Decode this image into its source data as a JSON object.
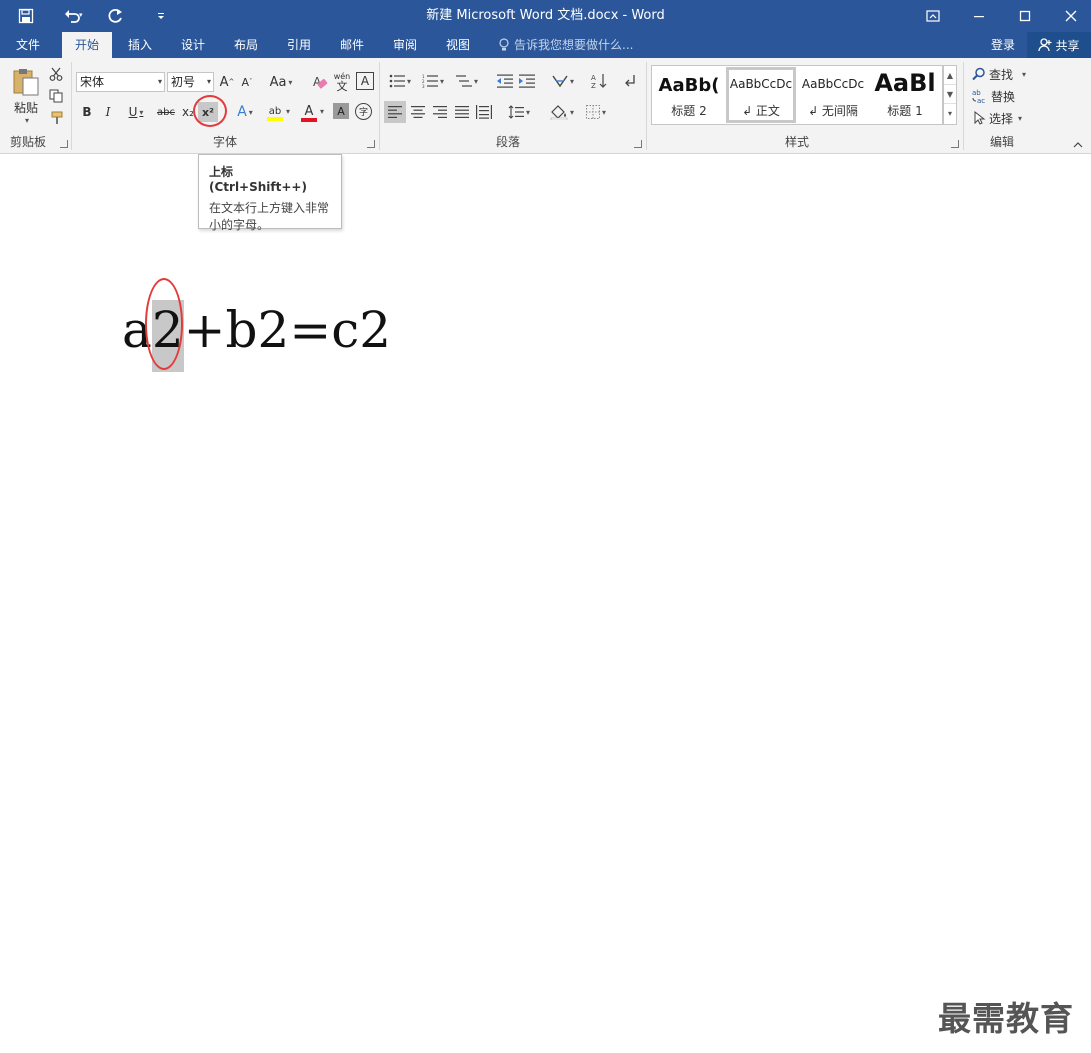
{
  "app": {
    "window_title": "新建 Microsoft Word 文档.docx - Word"
  },
  "quick_access": {
    "save": "save-icon",
    "undo": "undo-icon",
    "redo": "redo-icon",
    "customize": "customize-icon"
  },
  "tabs": [
    {
      "label": "文件"
    },
    {
      "label": "开始"
    },
    {
      "label": "插入"
    },
    {
      "label": "设计"
    },
    {
      "label": "布局"
    },
    {
      "label": "引用"
    },
    {
      "label": "邮件"
    },
    {
      "label": "审阅"
    },
    {
      "label": "视图"
    }
  ],
  "tell_me": {
    "placeholder": "告诉我您想要做什么..."
  },
  "account": {
    "login": "登录",
    "share": "共享"
  },
  "ribbon": {
    "clipboard": {
      "group_label": "剪贴板",
      "paste_label": "粘贴"
    },
    "font": {
      "group_label": "字体",
      "font_name": "宋体",
      "font_size": "初号",
      "bold": "B",
      "italic": "I",
      "underline": "U",
      "strikethrough": "abc",
      "subscript": "x₂",
      "superscript": "x²",
      "change_case": "Aa",
      "grow": "A",
      "shrink": "A",
      "phonetic_top": "wén",
      "phonetic_bottom": "文",
      "border_char": "A",
      "text_effects": "A",
      "highlight": "ab",
      "font_color": "A",
      "char_shading": "A",
      "enclose": "字"
    },
    "paragraph": {
      "group_label": "段落"
    },
    "styles": {
      "group_label": "样式",
      "items": [
        {
          "preview": "AaBb(",
          "name": "标题 2"
        },
        {
          "preview": "AaBbCcDc",
          "name": "↲ 正文"
        },
        {
          "preview": "AaBbCcDc",
          "name": "↲ 无间隔"
        },
        {
          "preview": "AaBl",
          "name": "标题 1"
        }
      ]
    },
    "editing": {
      "group_label": "编辑",
      "find": "查找",
      "replace": "替换",
      "select": "选择"
    }
  },
  "tooltip": {
    "title": "上标 (Ctrl+Shift++)",
    "body": "在文本行上方键入非常小的字母。"
  },
  "document": {
    "text_before": "a",
    "selected": "2",
    "text_after": "+b2=c2"
  },
  "watermark": "最需教育",
  "colors": {
    "brand": "#2b579a",
    "annotation": "#e33b3b",
    "highlight": "#ffff00",
    "font_color": "#e81123"
  }
}
